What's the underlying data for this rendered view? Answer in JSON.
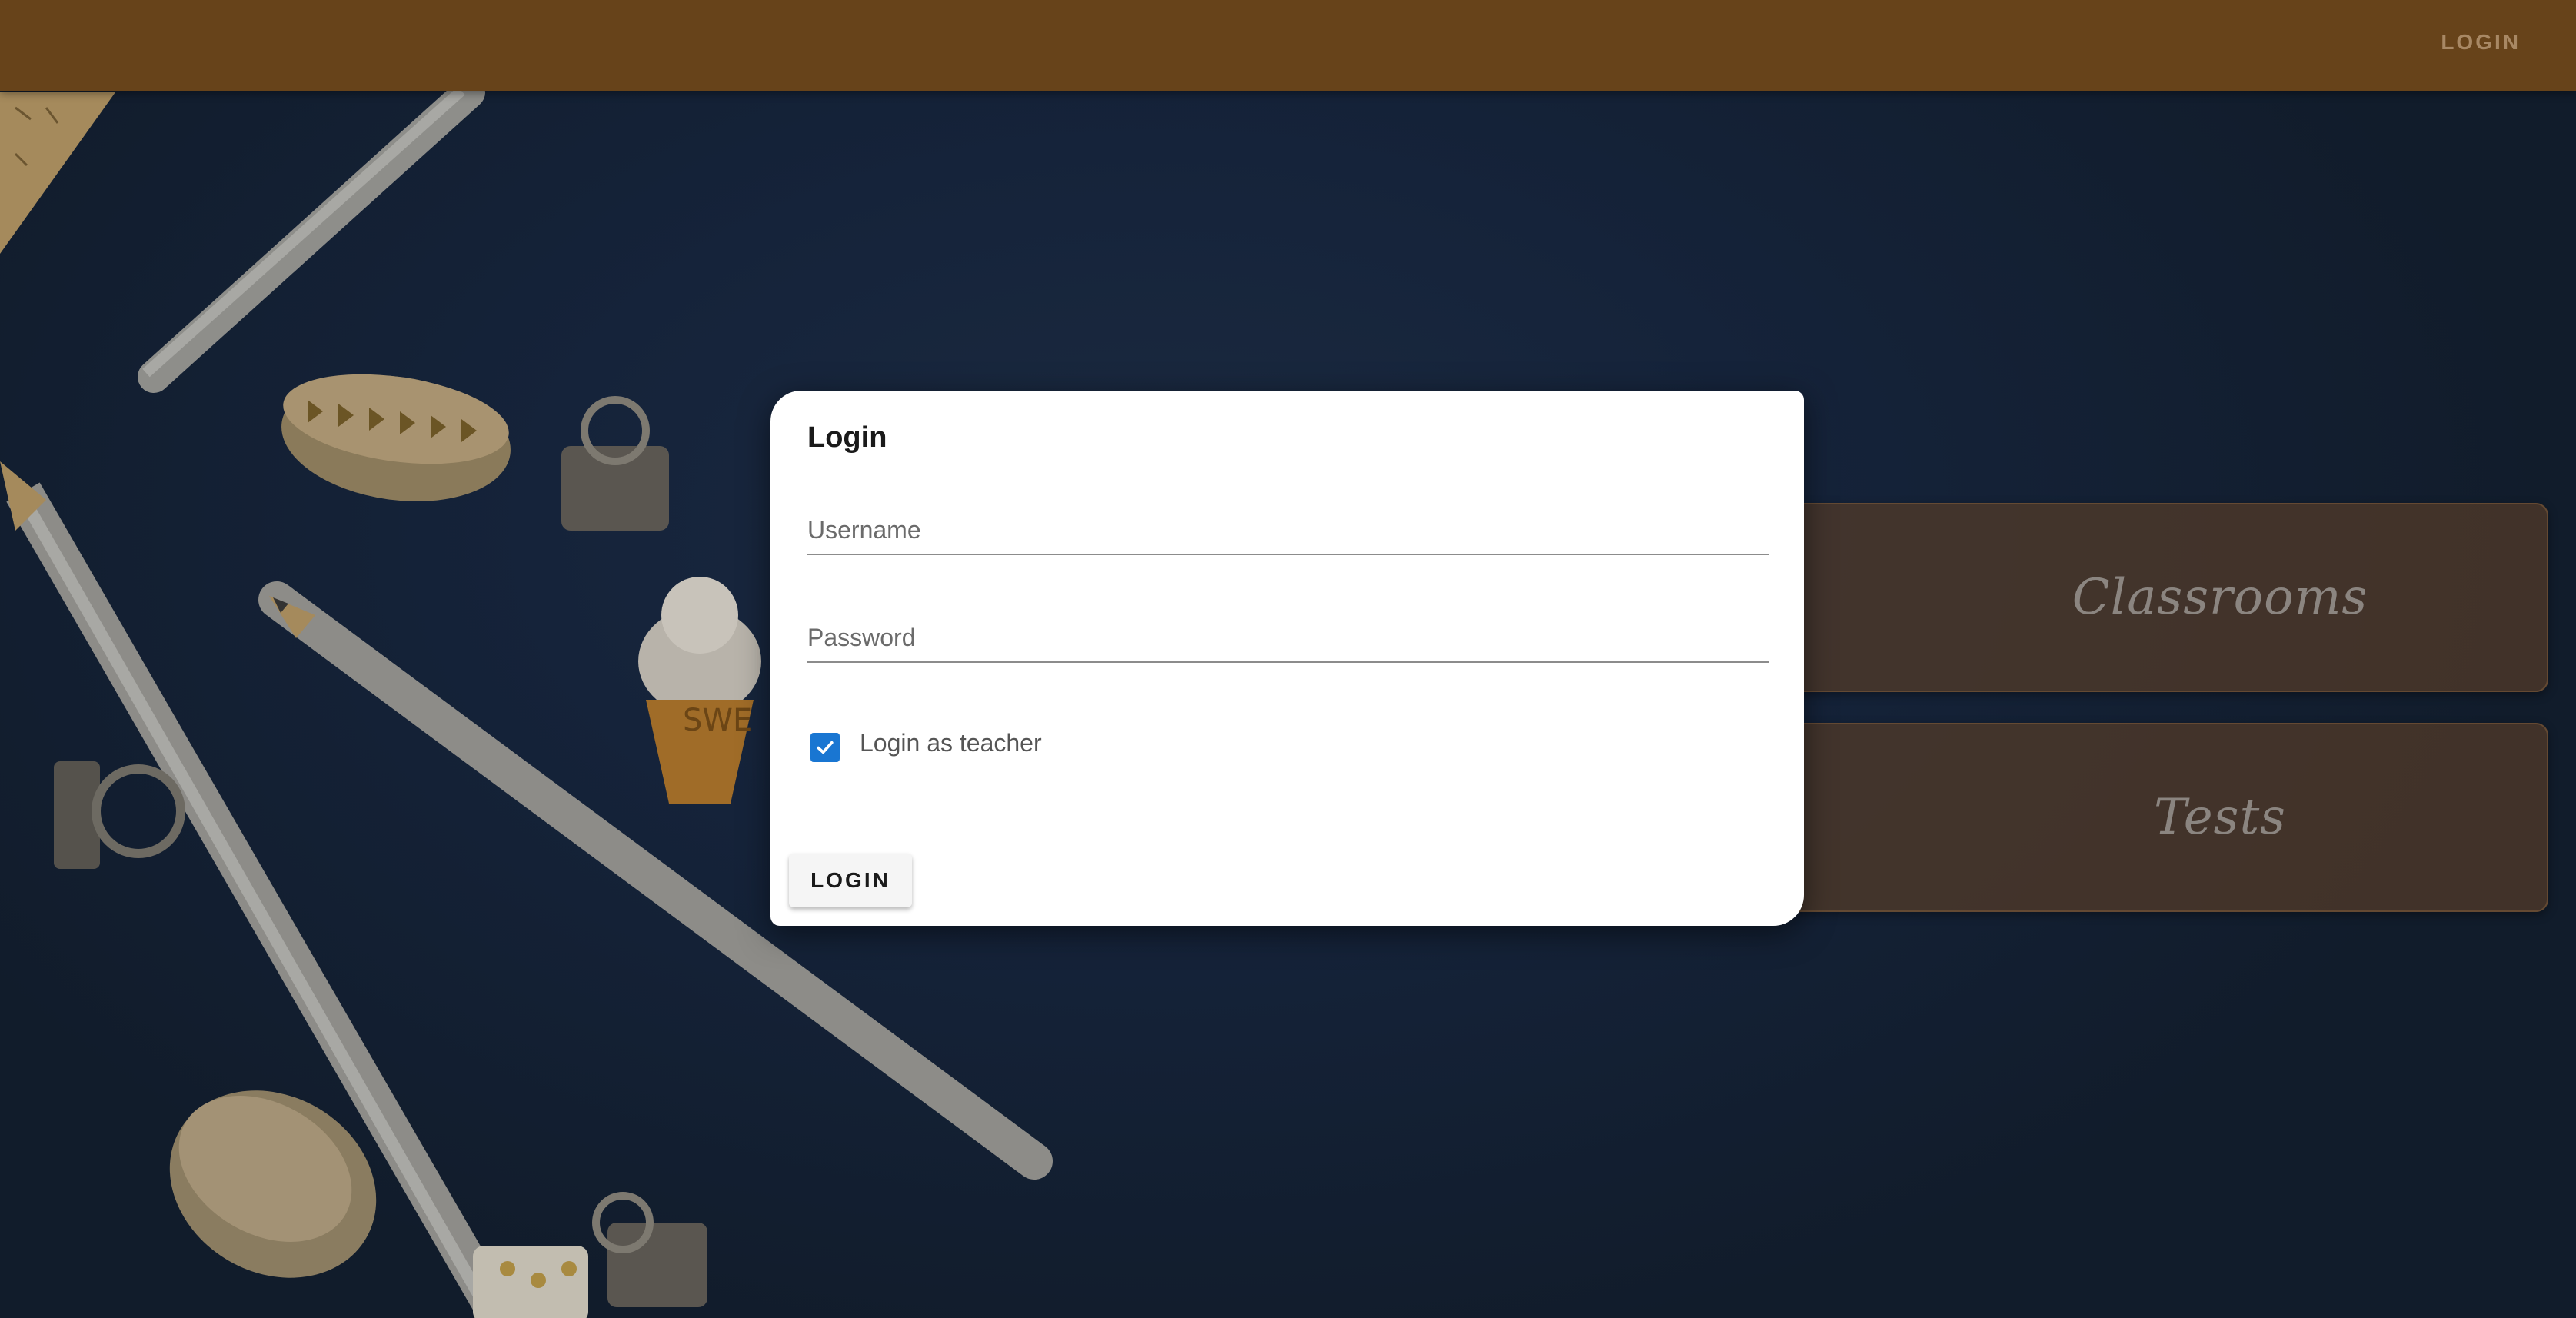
{
  "appbar": {
    "login_label": "LOGIN",
    "background": "#67431a"
  },
  "dialog": {
    "title": "Login",
    "username": {
      "value": "",
      "placeholder": "Username"
    },
    "password": {
      "value": "",
      "placeholder": "Password"
    },
    "teacher_checkbox": {
      "label": "Login as teacher",
      "checked": true
    },
    "submit_label": "LOGIN"
  },
  "side_cards": [
    {
      "label": "Classrooms"
    },
    {
      "label": "Tests"
    }
  ],
  "colors": {
    "accent": "#1976d2",
    "card": "#543c28"
  }
}
